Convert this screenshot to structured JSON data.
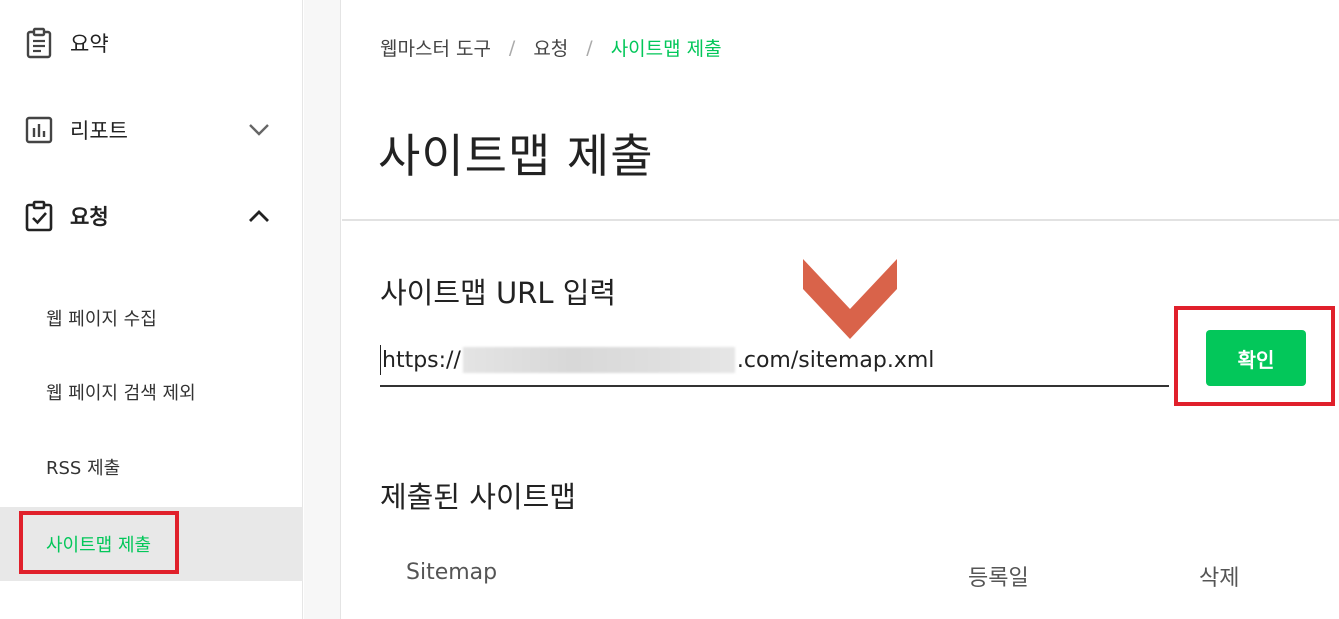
{
  "sidebar": {
    "items": [
      {
        "label": "요약",
        "icon": "clipboard-icon"
      },
      {
        "label": "리포트",
        "icon": "bar-chart-icon",
        "chevron": "chevron-down-icon"
      },
      {
        "label": "요청",
        "icon": "clipboard-check-icon",
        "chevron": "chevron-up-icon"
      }
    ],
    "subitems": [
      {
        "label": "웹 페이지 수집"
      },
      {
        "label": "웹 페이지 검색 제외"
      },
      {
        "label": "RSS 제출"
      },
      {
        "label": "사이트맵 제출",
        "active": true
      }
    ]
  },
  "breadcrumb": {
    "root": "웹마스터 도구",
    "separator": "/",
    "parent": "요청",
    "current": "사이트맵 제출"
  },
  "page": {
    "title": "사이트맵 제출"
  },
  "sitemap_form": {
    "label": "사이트맵 URL 입력",
    "url_prefix": "https://",
    "url_suffix": ".com/sitemap.xml",
    "submit_label": "확인"
  },
  "submitted": {
    "title": "제출된 사이트맵",
    "columns": [
      "Sitemap",
      "등록일",
      "삭제"
    ]
  },
  "colors": {
    "accent": "#03c75a",
    "highlight": "#e0202b",
    "arrow": "#d9634a"
  }
}
